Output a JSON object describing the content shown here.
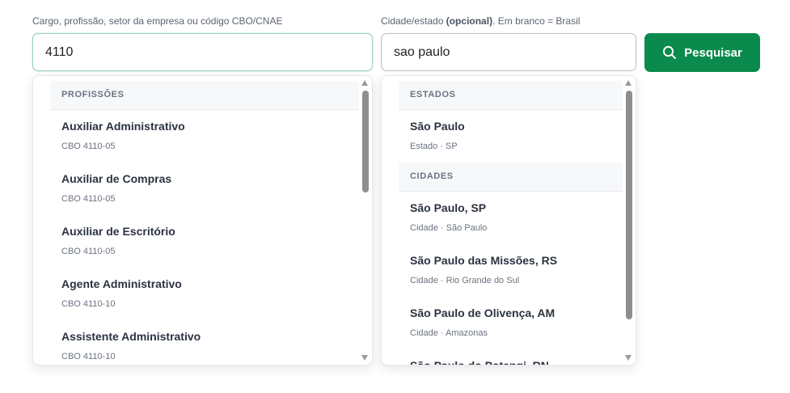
{
  "job_field": {
    "label_main": "Cargo, profissão, setor da empresa ou código CBO/CNAE",
    "value": "4110"
  },
  "city_field": {
    "label_main": "Cidade/estado",
    "label_optional": "(opcional)",
    "label_suffix": ". Em branco = Brasil",
    "value": "sao paulo"
  },
  "search_button": {
    "label": "Pesquisar",
    "icon": "search-icon"
  },
  "job_dropdown": {
    "group": "PROFISSÕES",
    "items": [
      {
        "title": "Auxiliar Administrativo",
        "sub": "CBO 4110-05"
      },
      {
        "title": "Auxiliar de Compras",
        "sub": "CBO 4110-05"
      },
      {
        "title": "Auxiliar de Escritório",
        "sub": "CBO 4110-05"
      },
      {
        "title": "Agente Administrativo",
        "sub": "CBO 4110-10"
      },
      {
        "title": "Assistente Administrativo",
        "sub": "CBO 4110-10"
      }
    ]
  },
  "city_dropdown": {
    "group_states": "ESTADOS",
    "states": [
      {
        "title": "São Paulo",
        "sub": "Estado · SP"
      }
    ],
    "group_cities": "CIDADES",
    "cities": [
      {
        "title": "São Paulo, SP",
        "sub": "Cidade · São Paulo"
      },
      {
        "title": "São Paulo das Missões, RS",
        "sub": "Cidade · Rio Grande do Sul"
      },
      {
        "title": "São Paulo de Olivença, AM",
        "sub": "Cidade · Amazonas"
      },
      {
        "title": "São Paulo do Potengi, RN",
        "sub": ""
      }
    ]
  },
  "colors": {
    "accent": "#0a8a4c",
    "focus_border": "#9fd3b7",
    "group_bg": "#f7f8fa",
    "muted_text": "#6b7280"
  }
}
